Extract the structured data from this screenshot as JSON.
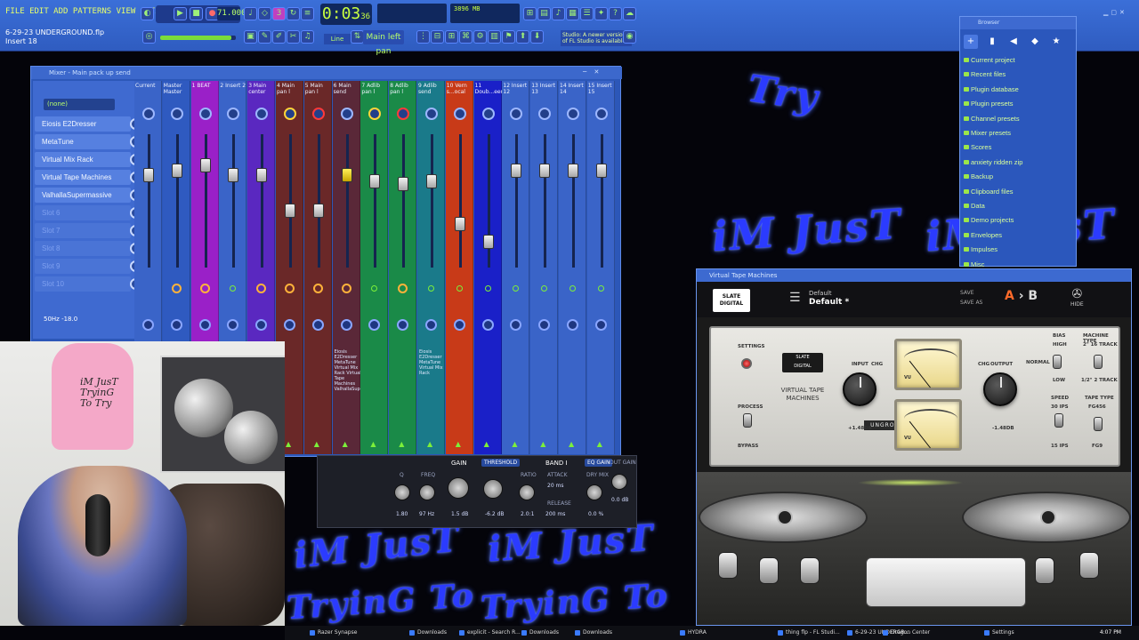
{
  "desktop": {
    "scribble_texts": [
      "Try",
      "iM JusT",
      "iM JusT",
      "iM JusT",
      "iM JusT",
      "TryinG To",
      "TryinG To"
    ]
  },
  "fl_toolbar": {
    "menu_text": "FILE EDIT ADD PATTERNS VIEW OPTIONS TOOLS HELP",
    "song_name": "6-29-23 UNDERGROUND.flp",
    "song_insert": "Insert 18",
    "tempo": "71.000",
    "time_main": "0:03",
    "time_sub": "36",
    "cpu_text": "3896 MB",
    "snap_label": "Main left pan",
    "line_mode": "Line",
    "hint_text": "Studio: A newer version of FL Studio is available!"
  },
  "mixer": {
    "title": "Mixer - Main pack up send",
    "preset_combo": "(none)",
    "eq_readout": "50Hz -18.0",
    "slots": [
      {
        "label": "Eiosis E2Dresser",
        "empty": false
      },
      {
        "label": "MetaTune",
        "empty": false
      },
      {
        "label": "Virtual Mix Rack",
        "empty": false
      },
      {
        "label": "Virtual Tape Machines",
        "empty": false
      },
      {
        "label": "ValhallaSupermassive",
        "empty": false
      },
      {
        "label": "Slot 6",
        "empty": true
      },
      {
        "label": "Slot 7",
        "empty": true
      },
      {
        "label": "Slot 8",
        "empty": true
      },
      {
        "label": "Slot 9",
        "empty": true
      },
      {
        "label": "Slot 10",
        "empty": true
      }
    ],
    "strips": [
      {
        "label": "Current",
        "color": "#3a64c8",
        "knob": "",
        "fader": 0.25,
        "fx": "none",
        "name": ""
      },
      {
        "label": "Master Master",
        "color": "#2f5ac0",
        "knob": "",
        "fader": 0.22,
        "fx": "ring",
        "name": "Drummer ST3"
      },
      {
        "label": "1 BEAT",
        "color": "#9a20c8",
        "knob": "",
        "fader": 0.18,
        "fx": "ring",
        "name": "Virtual Mix Rack"
      },
      {
        "label": "2 Insert 2",
        "color": "#3a64c8",
        "knob": "",
        "fader": 0.25,
        "fx": "green",
        "name": ""
      },
      {
        "label": "3 Main center",
        "color": "#5a28c0",
        "knob": "",
        "fader": 0.25,
        "fx": "ring",
        "name": "Eiosis E2Dresser MetaTune"
      },
      {
        "label": "4 Main pan l",
        "color": "#6a2828",
        "knob": "yel",
        "fader": 0.52,
        "fx": "ring",
        "name": ""
      },
      {
        "label": "5 Main pan l",
        "color": "#6a2828",
        "knob": "red",
        "fader": 0.52,
        "fx": "ring",
        "name": ""
      },
      {
        "label": "6 Main send",
        "color": "#5a2838",
        "knob": "",
        "fader": 0.25,
        "fx": "ring",
        "name": "Eiosis E2Dresser MetaTune Virtual Mix Rack Virtual Tape Machines ValhallaSupermassive"
      },
      {
        "label": "7 Adlib pan l",
        "color": "#1a8a48",
        "knob": "yel",
        "fader": 0.3,
        "fx": "green",
        "name": ""
      },
      {
        "label": "8 Adlib pan l",
        "color": "#1a8a48",
        "knob": "red",
        "fader": 0.32,
        "fx": "ring",
        "name": ""
      },
      {
        "label": "9 Adlib send",
        "color": "#1a7a8a",
        "knob": "",
        "fader": 0.3,
        "fx": "green",
        "name": "Eiosis E2Dresser MetaTune Virtual Mix Rack"
      },
      {
        "label": "10 Vern s...ocal",
        "color": "#c83a18",
        "knob": "",
        "fader": 0.62,
        "fx": "green",
        "name": ""
      },
      {
        "label": "11 Doub...eerst",
        "color": "#1a20c8",
        "knob": "",
        "fader": 0.75,
        "fx": "green",
        "name": ""
      },
      {
        "label": "12 Insert 12",
        "color": "#3a64c8",
        "knob": "",
        "fader": 0.22,
        "fx": "green",
        "name": ""
      },
      {
        "label": "13 Insert 13",
        "color": "#3a64c8",
        "knob": "",
        "fader": 0.22,
        "fx": "green",
        "name": ""
      },
      {
        "label": "14 Insert 14",
        "color": "#3a64c8",
        "knob": "",
        "fader": 0.22,
        "fx": "green",
        "name": ""
      },
      {
        "label": "15 Insert 15",
        "color": "#3a64c8",
        "knob": "",
        "fader": 0.22,
        "fx": "green",
        "name": ""
      }
    ]
  },
  "comp": {
    "gain_label": "GAIN",
    "threshold_tag": "THRESHOLD",
    "band_label": "BAND I",
    "eq_gain_tag": "EQ GAIN",
    "out_gain": "OUT GAIN",
    "freq": "FREQ",
    "q": "Q",
    "ratio": "RATIO",
    "attack": "ATTACK",
    "release": "RELEASE",
    "dry_mix": "DRY MIX",
    "v_q": "1.80",
    "v_freq": "97 Hz",
    "v_gain": "1.5 dB",
    "v_thr": "-6.2 dB",
    "v_ratio": "2.0:1",
    "v_attack": "20 ms",
    "v_release": "200 ms",
    "v_dry": "0.0 %",
    "v_out": "0.0 dB"
  },
  "browser": {
    "title": "Browser",
    "items": [
      "Current project",
      "Recent files",
      "Plugin database",
      "Plugin presets",
      "Channel presets",
      "Mixer presets",
      "Scores",
      "anxiety ridden zip",
      "Backup",
      "Clipboard files",
      "Data",
      "Demo projects",
      "Envelopes",
      "Impulses",
      "Misc"
    ]
  },
  "vtm": {
    "title": "Virtual Tape Machines",
    "logo_top": "SLATE",
    "logo_bottom": "DIGITAL",
    "preset_small": "Default",
    "preset_main": "Default *",
    "save": "SAVE",
    "save_as": "SAVE AS",
    "ab_a": "A",
    "ab_b": "B",
    "hide": "HIDE",
    "settings": "SETTINGS",
    "process": "PROCESS",
    "bypass": "BYPASS",
    "product_name": "VIRTUAL TAPE MACHINES",
    "input_label": "INPUT",
    "chg": "CHG",
    "input_value": "+1.48dB",
    "output_label": "OUTPUT",
    "output_value": "-1.48dB",
    "bias": "BIAS",
    "high": "HIGH",
    "normal": "NORMAL",
    "low": "LOW",
    "speed": "SPEED",
    "ips30": "30 ips",
    "ips15": "15 ips",
    "machine_type": "MACHINE TYPE",
    "track16": "2\" 16 TRACK",
    "track2": "1/2\" 2 TRACK",
    "tape_type": "TAPE TYPE",
    "fg456": "FG456",
    "fg9": "FG9",
    "ungrouped": "UNGROUPED",
    "vu_label": "VU"
  },
  "webcam": {
    "hoodie_text": "iM JusT TryinG To Try"
  },
  "taskbar": {
    "items": [
      "Razer Synapse",
      "Downloads",
      "explicit - Search R...",
      "Downloads",
      "Downloads",
      "HYDRA",
      "thing flp - FL Studi...",
      "6-29-23 UNDERGR...",
      "Dragon Center",
      "Settings"
    ],
    "clock": "4:07 PM"
  }
}
